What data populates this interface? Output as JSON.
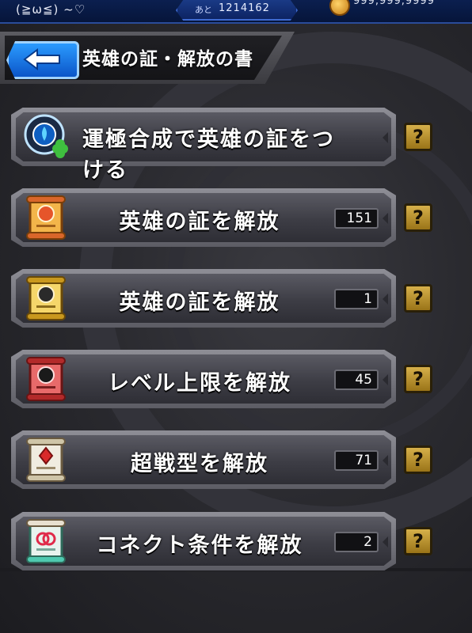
{
  "status_bar": {
    "player_name": "(≧ω≦) ~♡",
    "exp_label": "あと",
    "exp_value": "1214162",
    "coin_value": "999,999,9999"
  },
  "header": {
    "title": "英雄の証・解放の書",
    "back_icon": "back-arrow-icon"
  },
  "menu": {
    "items": [
      {
        "label": "運極合成で英雄の証をつける",
        "count": null,
        "icon": "luck-clover-icon"
      },
      {
        "label": "英雄の証を解放",
        "count": "151",
        "icon": "scroll-orange-icon"
      },
      {
        "label": "英雄の証を解放",
        "count": "1",
        "icon": "scroll-gold-icon"
      },
      {
        "label": "レベル上限を解放",
        "count": "45",
        "icon": "scroll-red-icon"
      },
      {
        "label": "超戦型を解放",
        "count": "71",
        "icon": "scroll-white-icon"
      },
      {
        "label": "コネクト条件を解放",
        "count": "2",
        "icon": "scroll-teal-icon"
      }
    ],
    "help_label": "?"
  },
  "colors": {
    "accent_blue": "#0b55c8",
    "help_gold": "#c9a23a",
    "panel_gray": "#3d3d45"
  }
}
